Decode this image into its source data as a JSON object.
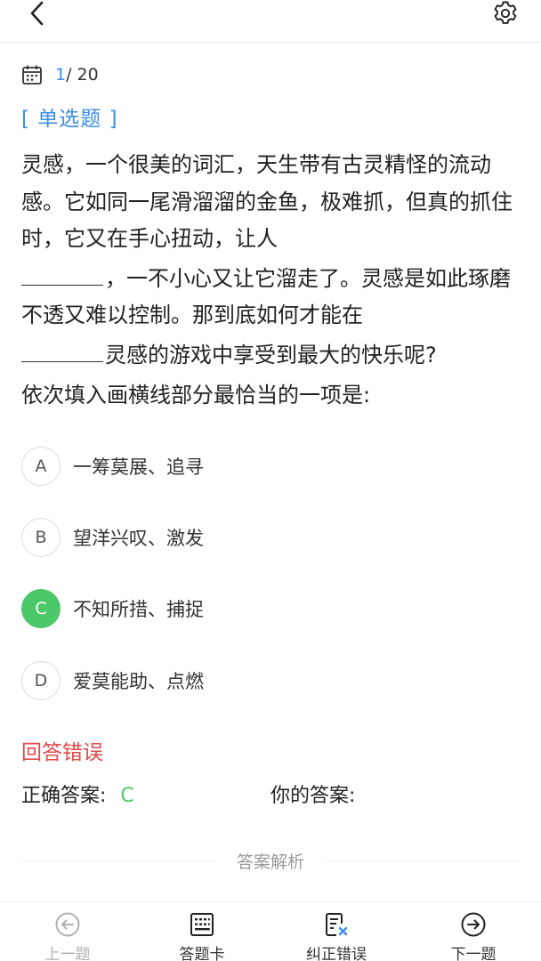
{
  "header": {
    "back_icon": "chevron-left-icon",
    "settings_icon": "gear-icon"
  },
  "progress": {
    "current": "1",
    "total": "/ 20"
  },
  "question": {
    "type": "[ 单选题 ]",
    "part1": "灵感，一个很美的词汇，天生带有古灵精怪的流动感。它如同一尾滑溜溜的金鱼，极难抓，但真的抓住时，它又在手心扭动，让人",
    "part2": "，一不小心又让它溜走了。灵感是如此琢磨不透又难以控制。那到底如何才能在",
    "part3": "灵感的游戏中享受到最大的快乐呢?",
    "prompt": "依次填入画横线部分最恰当的一项是:"
  },
  "options": [
    {
      "letter": "A",
      "text": "一筹莫展、追寻"
    },
    {
      "letter": "B",
      "text": "望洋兴叹、激发"
    },
    {
      "letter": "C",
      "text": "不知所措、捕捉"
    },
    {
      "letter": "D",
      "text": "爱莫能助、点燃"
    }
  ],
  "result": {
    "status": "回答错误",
    "correct_label": "正确答案:",
    "correct_value": "C",
    "your_label": "你的答案:"
  },
  "analysis_label": "答案解析",
  "nav": {
    "prev": "上一题",
    "card": "答题卡",
    "report": "纠正错误",
    "next": "下一题"
  },
  "colors": {
    "accent": "#3b8ee8",
    "correct": "#4cc76a",
    "error": "#e04a4a"
  }
}
